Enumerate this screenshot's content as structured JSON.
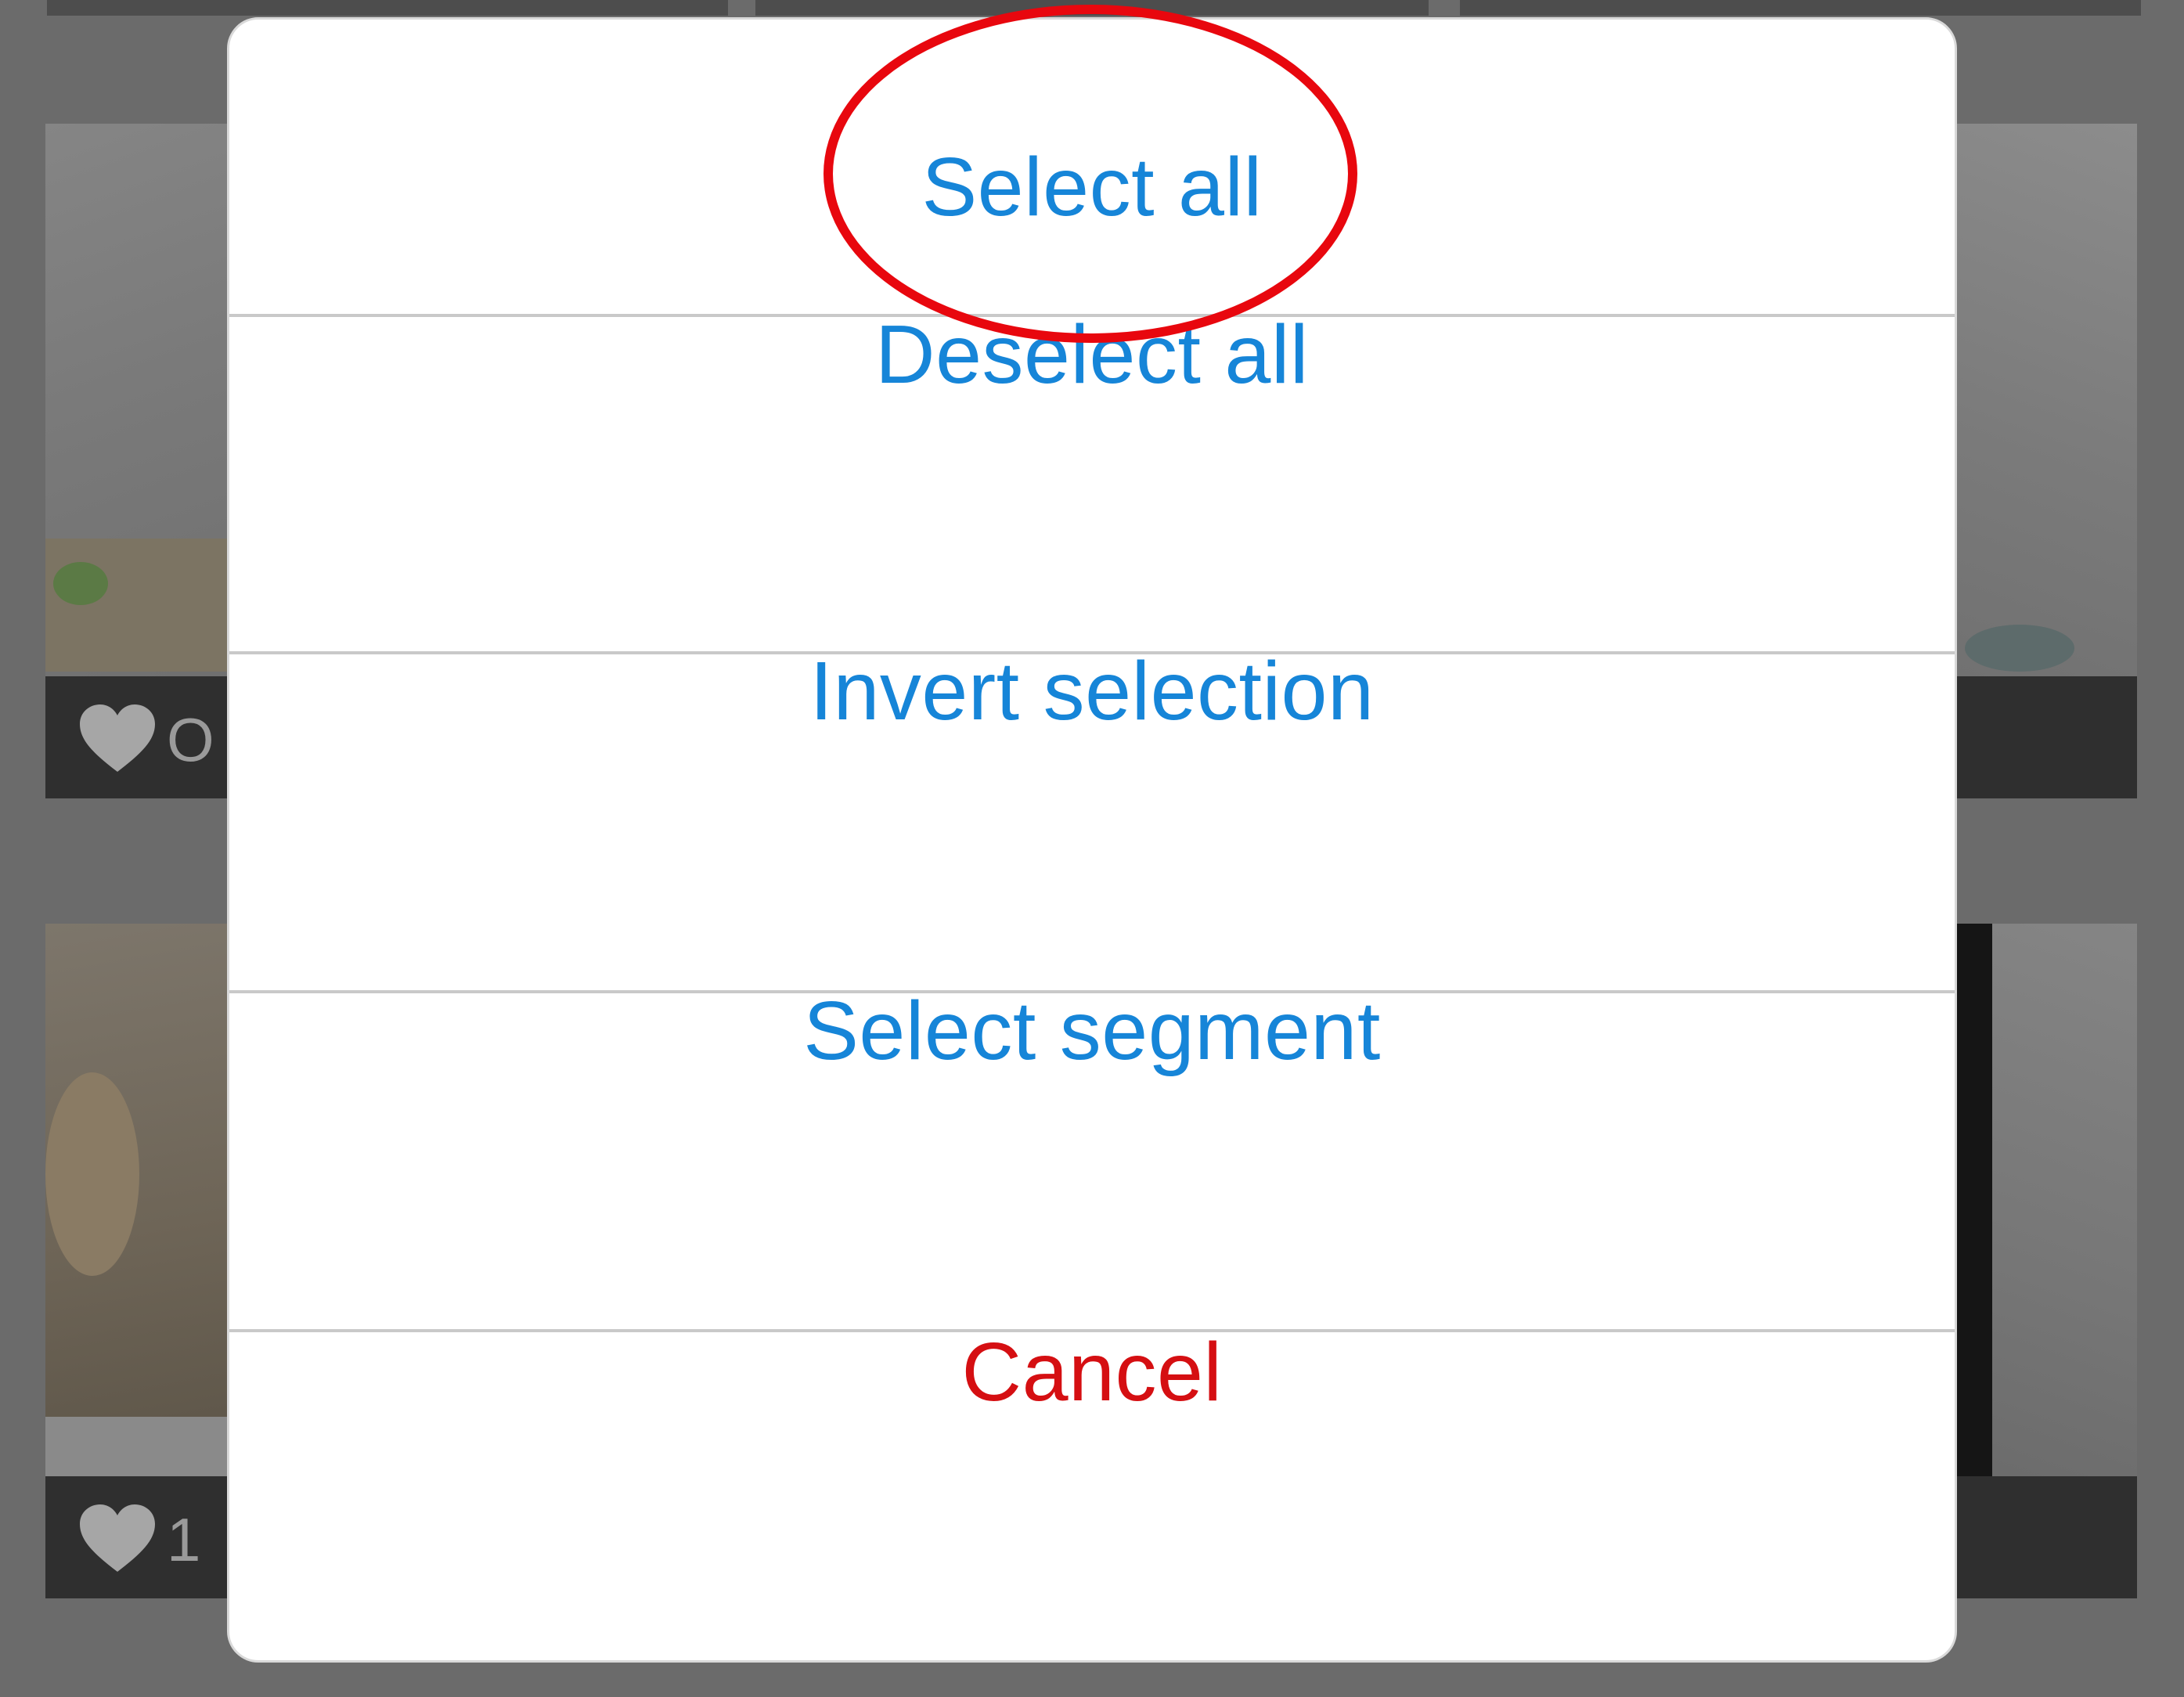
{
  "action_sheet": {
    "options": [
      {
        "label": "Select all"
      },
      {
        "label": "Deselect all"
      },
      {
        "label": "Invert selection"
      },
      {
        "label": "Select segment"
      }
    ],
    "cancel_label": "Cancel"
  },
  "background_grid": {
    "tiles": [
      {
        "likes": "O"
      },
      {
        "likes": "1"
      }
    ]
  },
  "colors": {
    "option_text": "#1685d8",
    "cancel_text": "#d50f12",
    "highlight_circle": "#e8070e",
    "overlay": "#6b6b6b"
  },
  "icons": {
    "like": "heart-icon"
  }
}
